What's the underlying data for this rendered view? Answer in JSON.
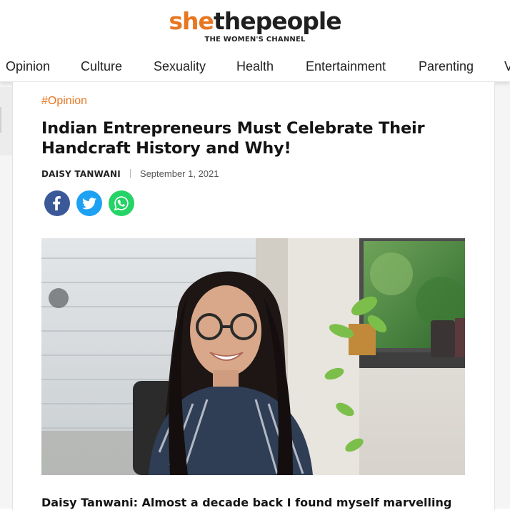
{
  "brand": {
    "logo_she": "she",
    "logo_rest": "thepeople",
    "tagline": "THE WOMEN'S CHANNEL",
    "accent_color": "#e87722"
  },
  "nav": {
    "items": [
      "Opinion",
      "Culture",
      "Sexuality",
      "Health",
      "Entertainment",
      "Parenting",
      "V"
    ]
  },
  "article": {
    "tag": "#Opinion",
    "title": "Indian Entrepreneurs Must Celebrate Their Handcraft History and Why!",
    "author": "DAISY TANWANI",
    "date": "September 1, 2021",
    "share": [
      {
        "name": "facebook",
        "icon": "facebook-icon",
        "color": "#3b5998"
      },
      {
        "name": "twitter",
        "icon": "twitter-icon",
        "color": "#1da1f2"
      },
      {
        "name": "whatsapp",
        "icon": "whatsapp-icon",
        "color": "#25d366"
      }
    ],
    "lead": "Daisy Tanwani: Almost a decade back I found myself marvelling"
  }
}
